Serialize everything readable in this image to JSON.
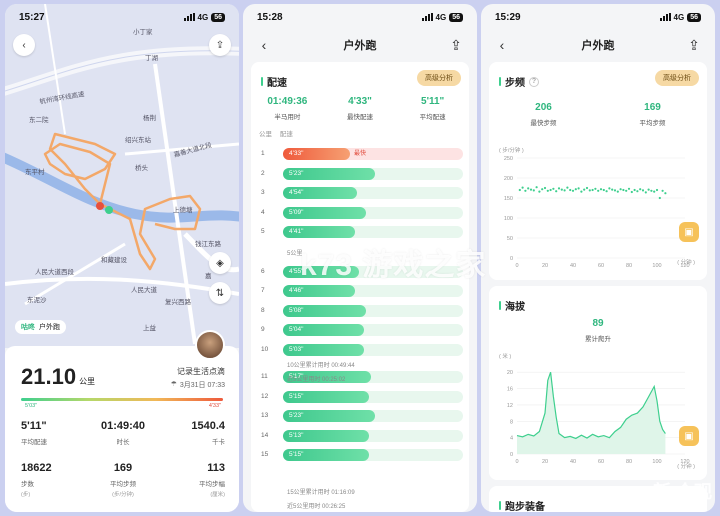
{
  "screens": [
    {
      "time": "15:27",
      "network": "4G",
      "battery": "56",
      "map": {
        "labels": [
          "小丁家",
          "丁湖",
          "杭州湾环线高速",
          "杨荆",
          "东二院",
          "绍兴东站",
          "嘉善大道北段",
          "东平村",
          "桥头",
          "上德塘",
          "和藏建设",
          "钱江东路",
          "人民大道西段",
          "东泥沙",
          "人民大道",
          "复兴西路",
          "上益",
          "嘉"
        ],
        "profile_name": "咕咚",
        "sport_type": "户外跑"
      },
      "summary": {
        "distance": "21.10",
        "distance_unit": "公里",
        "record_label": "记录生活点滴",
        "date": "3月31日 07:33",
        "pace_slow": "5'03\"",
        "pace_fast": "4'33\"",
        "stats_row1": [
          {
            "value": "5'11\"",
            "label": "平均配速"
          },
          {
            "value": "01:49:40",
            "label": "时长"
          },
          {
            "value": "1540.4",
            "label": "千卡"
          }
        ],
        "stats_row2": [
          {
            "value": "18622",
            "label": "步数",
            "sub": "(步)"
          },
          {
            "value": "169",
            "label": "平均步频",
            "sub": "(步/分钟)"
          },
          {
            "value": "113",
            "label": "平均步幅",
            "sub": "(厘米)"
          }
        ]
      }
    },
    {
      "time": "15:28",
      "title": "户外跑",
      "section": "配速",
      "advanced": "高级分析",
      "stats": [
        {
          "value": "01:49:36",
          "label": "半马用时"
        },
        {
          "value": "4'33\"",
          "label": "最快配速"
        },
        {
          "value": "5'11\"",
          "label": "平均配速"
        }
      ],
      "col_km": "公里",
      "col_pace": "配速",
      "fastest_tag": "最快",
      "splits": [
        {
          "km": "1",
          "pace": "4'33\"",
          "frac": 0.37,
          "fast": true
        },
        {
          "km": "2",
          "pace": "5'23\"",
          "frac": 0.51
        },
        {
          "km": "3",
          "pace": "4'54\"",
          "frac": 0.41
        },
        {
          "km": "4",
          "pace": "5'09\"",
          "frac": 0.46
        },
        {
          "km": "5",
          "pace": "4'41\"",
          "frac": 0.4
        },
        {
          "km": "6",
          "pace": "4'55\"",
          "frac": 0.42
        },
        {
          "km": "7",
          "pace": "4'46\"",
          "frac": 0.4
        },
        {
          "km": "8",
          "pace": "5'08\"",
          "frac": 0.46
        },
        {
          "km": "9",
          "pace": "5'04\"",
          "frac": 0.45
        },
        {
          "km": "10",
          "pace": "5'03\"",
          "frac": 0.45
        },
        {
          "km": "11",
          "pace": "5'17\"",
          "frac": 0.49
        },
        {
          "km": "12",
          "pace": "5'15\"",
          "frac": 0.48
        },
        {
          "km": "13",
          "pace": "5'23\"",
          "frac": 0.51
        },
        {
          "km": "14",
          "pace": "5'13\"",
          "frac": 0.48
        },
        {
          "km": "15",
          "pace": "5'15\"",
          "frac": 0.48
        }
      ],
      "notes": {
        "five_km": "5公里",
        "ten_total": "10公里累计用时 00:49:44",
        "ten_last5": "近5公里用时 00:25:02",
        "fifteen_total": "15公里累计用时 01:16:09",
        "fifteen_last5": "近5公里用时 00:26:25"
      }
    },
    {
      "time": "15:29",
      "title": "户外跑",
      "cadence": {
        "section": "步频",
        "advanced": "高级分析",
        "max": "206",
        "max_label": "最快步频",
        "avg": "169",
        "avg_label": "平均步频",
        "unit": "( 步/分钟 )",
        "x_unit": "( 分钟 )"
      },
      "elevation": {
        "section": "海拔",
        "gain": "89",
        "gain_label": "累计爬升",
        "unit": "( 米 )",
        "x_unit": "( 分钟 )"
      },
      "gear_section": "跑步装备"
    }
  ],
  "watermark": "k73 游戏之家",
  "watermark2": "新 众观",
  "chart_data": [
    {
      "type": "scatter",
      "title": "步频",
      "ylabel": "( 步/分钟 )",
      "xlabel": "( 分钟 )",
      "xlim": [
        0,
        120
      ],
      "ylim": [
        0,
        250
      ],
      "xticks": [
        0,
        20,
        40,
        60,
        80,
        100,
        120
      ],
      "yticks": [
        0,
        50,
        100,
        150,
        200,
        250
      ],
      "series": [
        {
          "x": [
            2,
            4,
            6,
            8,
            10,
            12,
            14,
            16,
            18,
            20,
            22,
            24,
            26,
            28,
            30,
            32,
            34,
            36,
            38,
            40,
            42,
            44,
            46,
            48,
            50,
            52,
            54,
            56,
            58,
            60,
            62,
            64,
            66,
            68,
            70,
            72,
            74,
            76,
            78,
            80,
            82,
            84,
            86,
            88,
            90,
            92,
            94,
            96,
            98,
            100,
            102,
            104,
            106
          ],
          "y": [
            170,
            176,
            168,
            174,
            171,
            169,
            177,
            166,
            172,
            175,
            168,
            170,
            173,
            167,
            174,
            171,
            169,
            176,
            170,
            168,
            172,
            174,
            166,
            171,
            175,
            169,
            170,
            173,
            168,
            172,
            170,
            167,
            174,
            171,
            169,
            166,
            172,
            170,
            168,
            173,
            165,
            170,
            167,
            172,
            169,
            164,
            171,
            168,
            166,
            170,
            150,
            168,
            162
          ]
        }
      ]
    },
    {
      "type": "area",
      "title": "海拔",
      "ylabel": "( 米 )",
      "xlabel": "( 分钟 )",
      "xlim": [
        0,
        120
      ],
      "ylim": [
        0,
        22
      ],
      "xticks": [
        0,
        20,
        40,
        60,
        80,
        100,
        120
      ],
      "yticks": [
        0,
        4,
        8,
        12,
        16,
        20
      ],
      "x": [
        0,
        4,
        8,
        12,
        16,
        20,
        22,
        24,
        26,
        28,
        30,
        34,
        38,
        42,
        46,
        50,
        54,
        58,
        62,
        66,
        70,
        74,
        78,
        82,
        86,
        90,
        94,
        98,
        100,
        102,
        104,
        106
      ],
      "y": [
        4.5,
        4.2,
        4.8,
        4.4,
        5.5,
        10,
        18,
        20,
        14,
        9,
        5,
        4,
        4.3,
        3.8,
        4.6,
        3.9,
        4.8,
        4.2,
        4.5,
        4,
        5.5,
        6.5,
        8.5,
        9.5,
        10,
        11.5,
        14,
        16.5,
        13,
        8,
        6,
        5
      ]
    }
  ]
}
